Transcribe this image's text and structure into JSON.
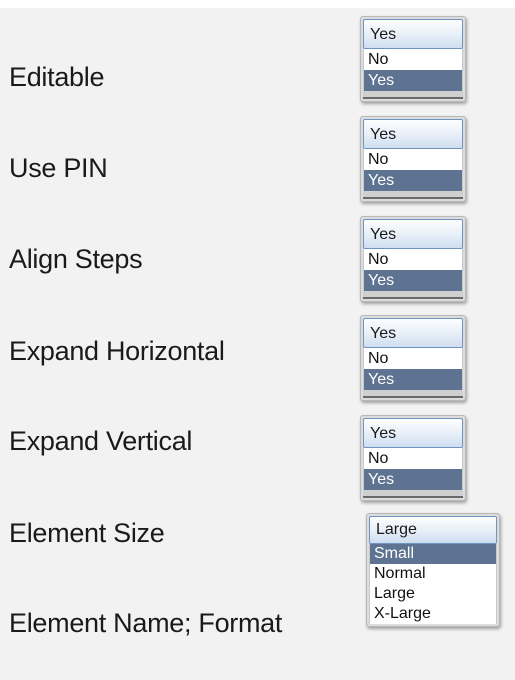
{
  "rows": [
    {
      "label": "Editable",
      "selected": "Yes",
      "options": [
        "No",
        "Yes"
      ],
      "highlighted": "Yes"
    },
    {
      "label": "Use PIN",
      "selected": "Yes",
      "options": [
        "No",
        "Yes"
      ],
      "highlighted": "Yes"
    },
    {
      "label": "Align Steps",
      "selected": "Yes",
      "options": [
        "No",
        "Yes"
      ],
      "highlighted": "Yes"
    },
    {
      "label": "Expand Horizontal",
      "selected": "Yes",
      "options": [
        "No",
        "Yes"
      ],
      "highlighted": "Yes"
    },
    {
      "label": "Expand Vertical",
      "selected": "Yes",
      "options": [
        "No",
        "Yes"
      ],
      "highlighted": "Yes"
    }
  ],
  "element_size": {
    "label": "Element Size",
    "selected": "Large",
    "options": [
      "Small",
      "Normal",
      "Large",
      "X-Large"
    ],
    "highlighted": "Small"
  },
  "element_name_format": {
    "label": "Element Name; Format"
  },
  "colors": {
    "highlight_bg": "#5e7391",
    "selected_border": "#6f94c0"
  }
}
